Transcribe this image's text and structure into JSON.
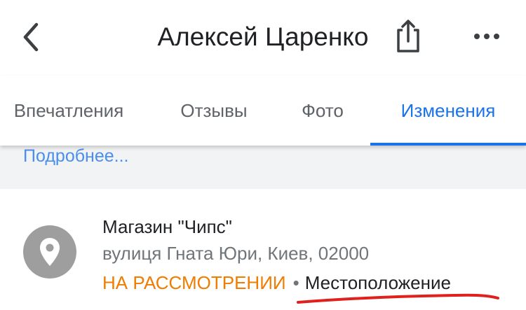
{
  "header": {
    "title": "Алексей Царенко",
    "back_icon": "chevron-left-icon",
    "share_icon": "share-icon",
    "more_icon": "more-horizontal-icon"
  },
  "tabs": [
    {
      "label": "Впечатления",
      "active": false
    },
    {
      "label": "Отзывы",
      "active": false
    },
    {
      "label": "Фото",
      "active": false
    },
    {
      "label": "Изменения",
      "active": true
    }
  ],
  "more_link": "Подробнее...",
  "edit_item": {
    "icon": "location-pin-icon",
    "name": "Магазин \"Чипс\"",
    "address": "вулиця Гната Юри, Киев, 02000",
    "status": "НА РАССМОТРЕНИИ",
    "separator": "•",
    "change_type": "Местоположение"
  },
  "colors": {
    "accent": "#1a73e8",
    "status_pending": "#f07c00",
    "annotation": "#e0201c"
  }
}
